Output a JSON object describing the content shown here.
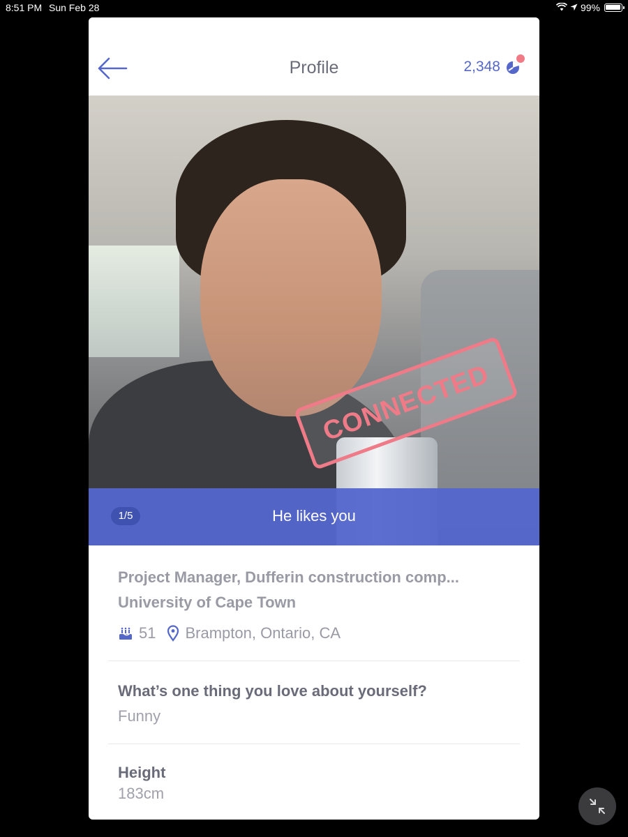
{
  "status_bar": {
    "time": "8:51 PM",
    "date": "Sun Feb 28",
    "battery": "99%",
    "battery_level": 0.99
  },
  "header": {
    "title": "Profile",
    "coins": "2,348",
    "back_icon": "arrow-left-icon",
    "coin_icon": "pie-coin-icon"
  },
  "photo": {
    "stamp": "CONNECTED",
    "counter": "1/5",
    "likes_text": "He likes you"
  },
  "profile": {
    "job": "Project Manager, Dufferin construction comp...",
    "school": "University of Cape Town",
    "age": "51",
    "location": "Brampton, Ontario, CA"
  },
  "questions": [
    {
      "question": "What’s one thing you love about yourself?",
      "answer": "Funny"
    },
    {
      "question": "Height",
      "answer": "183cm"
    }
  ],
  "colors": {
    "accent": "#5567c9",
    "stamp": "#ee7b87",
    "muted_text": "#9a9aa5"
  }
}
